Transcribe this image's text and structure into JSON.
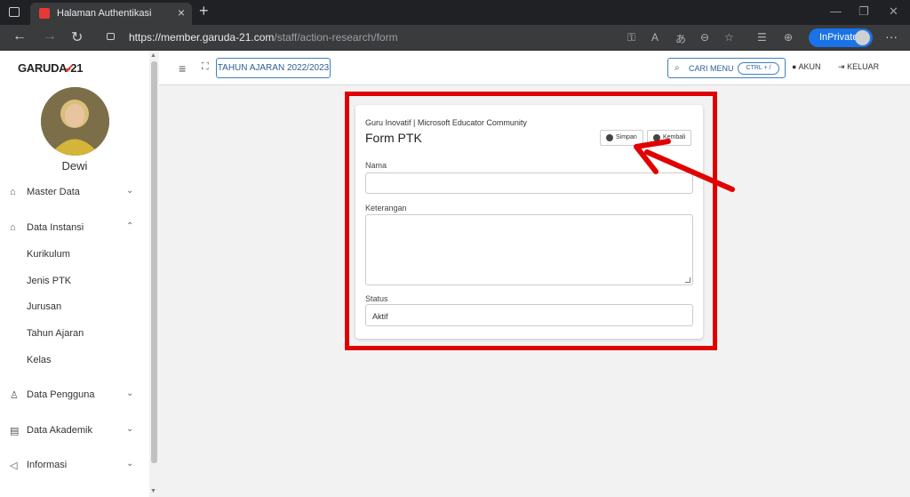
{
  "browser": {
    "tab_title": "Halaman Authentikasi",
    "url_host": "https://member.garuda-21.com",
    "url_path": "/staff/action-research/form",
    "inprivate_label": "InPrivate"
  },
  "sidebar": {
    "logo": "GARUDA-21",
    "user_name": "Dewi",
    "items": [
      {
        "label": "Master Data"
      },
      {
        "label": "Data Instansi"
      },
      {
        "label": "Data Pengguna"
      },
      {
        "label": "Data Akademik"
      },
      {
        "label": "Informasi"
      }
    ],
    "sub_items": [
      {
        "label": "Kurikulum"
      },
      {
        "label": "Jenis PTK"
      },
      {
        "label": "Jurusan"
      },
      {
        "label": "Tahun Ajaran"
      },
      {
        "label": "Kelas"
      }
    ]
  },
  "topbar": {
    "tahun_ajaran": "TAHUN AJARAN 2022/2023",
    "cari_menu": "CARI MENU",
    "shortcut": "CTRL + /",
    "akun": "AKUN",
    "keluar": "KELUAR"
  },
  "form": {
    "supertitle": "Guru Inovatif | Microsoft Educator Community",
    "title": "Form PTK",
    "save_label": "Simpan",
    "back_label": "Kembali",
    "nama_label": "Nama",
    "nama_value": "",
    "keterangan_label": "Keterangan",
    "keterangan_value": "",
    "status_label": "Status",
    "status_value": "Aktif"
  },
  "colors": {
    "annotation": "#e00000",
    "primary_outline": "#3d7fc0",
    "chrome_dark": "#202124"
  }
}
